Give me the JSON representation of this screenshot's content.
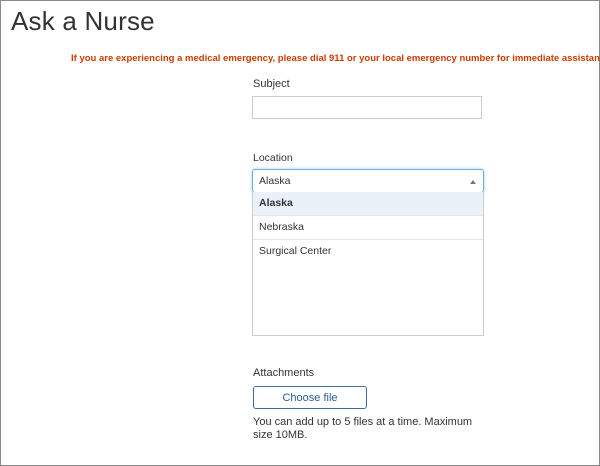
{
  "page": {
    "title": "Ask a Nurse",
    "emergency_notice": "If you are experiencing a medical emergency, please dial 911 or your local emergency number for immediate assistance."
  },
  "form": {
    "subject_label": "Subject",
    "subject_value": "",
    "location_label": "Location",
    "location_selected": "Alaska",
    "location_options": [
      "Alaska",
      "Nebraska",
      "Surgical Center"
    ],
    "attachments_label": "Attachments",
    "choose_file_label": "Choose file",
    "attachments_help": "You can add up to 5 files at a time. Maximum size 10MB."
  },
  "colors": {
    "emergency_text": "#d03a00",
    "button_border": "#3a6ea5",
    "focus_border": "#66afe9"
  }
}
